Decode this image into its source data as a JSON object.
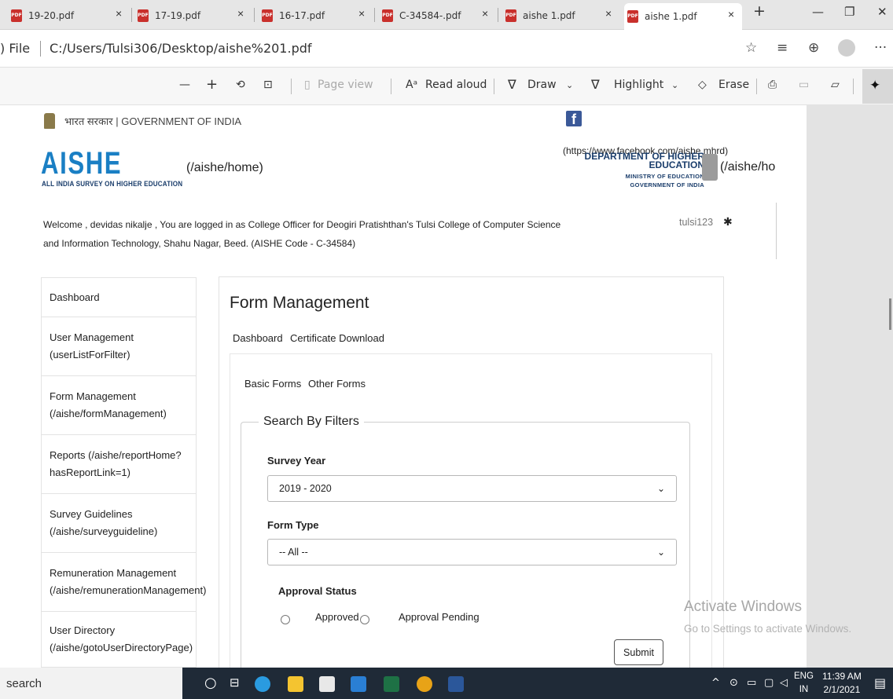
{
  "browser": {
    "tabs": [
      {
        "title": "19-20.pdf"
      },
      {
        "title": "17-19.pdf"
      },
      {
        "title": "16-17.pdf"
      },
      {
        "title": "C-34584-.pdf"
      },
      {
        "title": "aishe 1.pdf"
      },
      {
        "title": "aishe 1.pdf"
      }
    ],
    "close_glyph": "×",
    "new_tab_glyph": "+",
    "address_prefix": ") File",
    "address": "C:/Users/Tulsi306/Desktop/aishe%201.pdf",
    "minimize": "—",
    "restore": "❐",
    "close": "✕",
    "more": "···"
  },
  "pdf_toolbar": {
    "zoom_out": "—",
    "zoom_in": "+",
    "rotate": "⟲",
    "fit": "⊡",
    "page_view": "Page view",
    "read_aloud": "Read aloud",
    "draw": "Draw",
    "highlight": "Highlight",
    "erase": "Erase"
  },
  "header": {
    "gov_line": "भारत सरकार | GOVERNMENT OF INDIA",
    "logo": "AISHE",
    "logo_sub": "ALL INDIA SURVEY ON HIGHER EDUCATION",
    "home_link": "(/aishe/home)",
    "fb_link": "(https://www.facebook.com/aishe.mhrd)",
    "dhe_title": "DEPARTMENT OF HIGHER EDUCATION",
    "dhe_ministry": "MINISTRY OF EDUCATION",
    "dhe_gov": "GOVERNMENT OF INDIA",
    "ho_link": "(/aishe/ho",
    "welcome": "Welcome , devidas nikalje , You are logged in as College Officer for Deogiri Pratishthan's Tulsi College of Computer Science and Information Technology, Shahu Nagar, Beed. (AISHE Code - C-34584)",
    "username": "tulsi123"
  },
  "sidebar": {
    "items": [
      {
        "label": "Dashboard"
      },
      {
        "label": "User Management (userListForFilter)"
      },
      {
        "label": "Form Management (/aishe/formManagement)"
      },
      {
        "label": "Reports (/aishe/reportHome?hasReportLink=1)"
      },
      {
        "label": "Survey Guidelines (/aishe/surveyguideline)"
      },
      {
        "label": "Remuneration Management (/aishe/remunerationManagement)"
      },
      {
        "label": "User Directory (/aishe/gotoUserDirectoryPage)"
      }
    ]
  },
  "main": {
    "title": "Form Management",
    "tabs": [
      "Dashboard",
      "Certificate Download"
    ],
    "subtabs": [
      "Basic Forms",
      "Other Forms"
    ],
    "filters_legend": "Search By Filters",
    "survey_year_label": "Survey Year",
    "survey_year_value": "2019 - 2020",
    "form_type_label": "Form Type",
    "form_type_value": "-- All --",
    "approval_label": "Approval Status",
    "approved": "Approved",
    "pending": "Approval Pending",
    "submit": "Submit"
  },
  "watermark": {
    "line1": "Activate Windows",
    "line2": "Go to Settings to activate Windows."
  },
  "taskbar": {
    "search": "search",
    "lang1": "ENG",
    "lang2": "IN",
    "time": "11:39 AM",
    "date": "2/1/2021"
  },
  "colors": {
    "accent": "#1a7fc4",
    "taskbar": "#1f2a37"
  }
}
